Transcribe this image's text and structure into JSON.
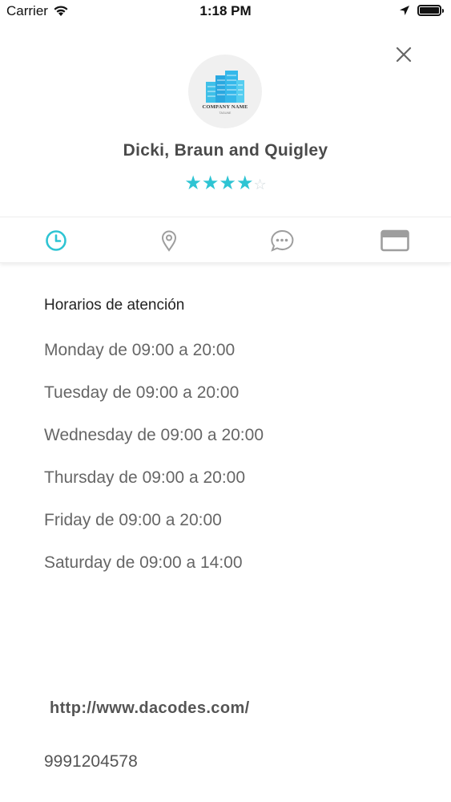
{
  "status_bar": {
    "carrier": "Carrier",
    "time": "1:18 PM"
  },
  "profile": {
    "logo_text": "COMPANY NAME",
    "logo_tagline": "TAGLINE",
    "company_name": "Dicki, Braun and Quigley",
    "rating": 4,
    "rating_max": 5
  },
  "tabs": [
    {
      "icon": "clock-icon",
      "active": true
    },
    {
      "icon": "location-pin-icon",
      "active": false
    },
    {
      "icon": "chat-bubble-icon",
      "active": false
    },
    {
      "icon": "card-icon",
      "active": false
    }
  ],
  "colors": {
    "accent": "#2ec4d3",
    "inactive_icon": "#9e9e9e",
    "text_gray": "#666666"
  },
  "schedule": {
    "heading": "Horarios de atención",
    "hours": [
      "Monday de 09:00 a 20:00",
      "Tuesday de 09:00 a 20:00",
      "Wednesday de 09:00 a 20:00",
      "Thursday de 09:00 a 20:00",
      "Friday de 09:00 a 20:00",
      "Saturday de 09:00 a 14:00"
    ]
  },
  "contact": {
    "website": "http://www.dacodes.com/",
    "phone": "9991204578"
  }
}
